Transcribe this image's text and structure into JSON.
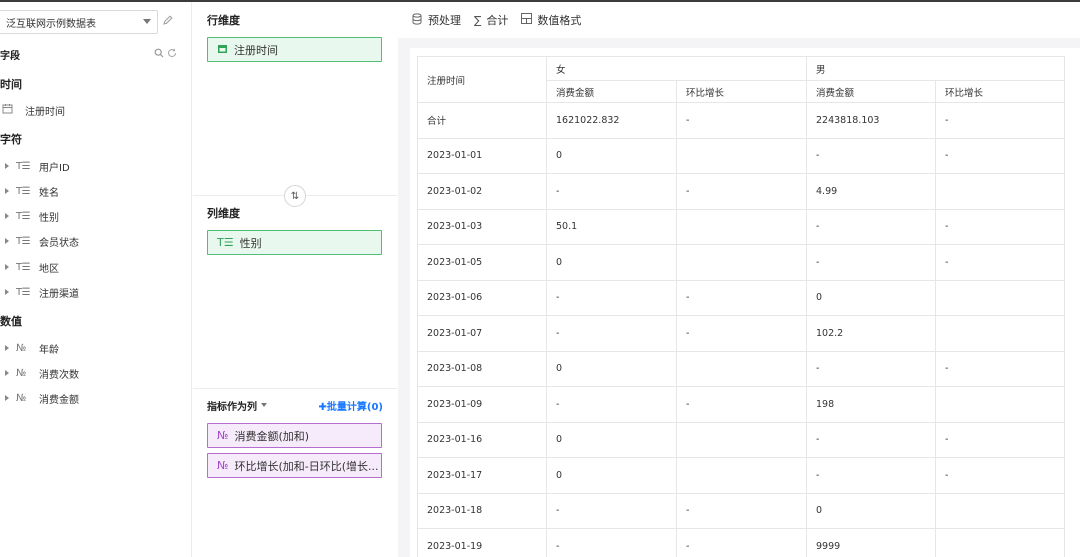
{
  "datasource": {
    "name": "泛互联网示例数据表"
  },
  "fields_panel": {
    "title": "字段",
    "groups": [
      {
        "title": "时间",
        "items": [
          {
            "icon": "calendar-icon",
            "label": "注册时间"
          }
        ]
      },
      {
        "title": "字符",
        "items": [
          {
            "icon": "text-type-icon",
            "label": "用户ID"
          },
          {
            "icon": "text-type-icon",
            "label": "姓名"
          },
          {
            "icon": "text-type-icon",
            "label": "性别"
          },
          {
            "icon": "text-type-icon",
            "label": "会员状态"
          },
          {
            "icon": "text-type-icon",
            "label": "地区"
          },
          {
            "icon": "text-type-icon",
            "label": "注册渠道"
          }
        ]
      },
      {
        "title": "数值",
        "items": [
          {
            "icon": "number-type-icon",
            "label": "年龄"
          },
          {
            "icon": "number-type-icon",
            "label": "消费次数"
          },
          {
            "icon": "number-type-icon",
            "label": "消费金额"
          }
        ]
      }
    ]
  },
  "dimensions": {
    "row_title": "行维度",
    "row_chip": "注册时间",
    "col_title": "列维度",
    "col_chip": "性别",
    "metrics_label": "指标作为列",
    "batch_calc": "批量计算(0)",
    "metric_chips": [
      "消费金额(加和)",
      "环比增长(加和-日环比(增长..."
    ]
  },
  "toolbar": {
    "preprocess": "预处理",
    "total": "合计",
    "number_format": "数值格式"
  },
  "table": {
    "row_header": "注册时间",
    "groups": [
      "女",
      "男"
    ],
    "sub_headers": [
      "消费金额",
      "环比增长",
      "消费金额",
      "环比增长"
    ],
    "rows": [
      [
        "合计",
        "1621022.832",
        "-",
        "2243818.103",
        "-"
      ],
      [
        "2023-01-01",
        "0",
        "",
        "-",
        "-"
      ],
      [
        "2023-01-02",
        "-",
        "-",
        "4.99",
        ""
      ],
      [
        "2023-01-03",
        "50.1",
        "",
        "-",
        "-"
      ],
      [
        "2023-01-05",
        "0",
        "",
        "-",
        "-"
      ],
      [
        "2023-01-06",
        "-",
        "-",
        "0",
        ""
      ],
      [
        "2023-01-07",
        "-",
        "-",
        "102.2",
        ""
      ],
      [
        "2023-01-08",
        "0",
        "",
        "-",
        "-"
      ],
      [
        "2023-01-09",
        "-",
        "-",
        "198",
        ""
      ],
      [
        "2023-01-16",
        "0",
        "",
        "-",
        "-"
      ],
      [
        "2023-01-17",
        "0",
        "",
        "-",
        "-"
      ],
      [
        "2023-01-18",
        "-",
        "-",
        "0",
        ""
      ],
      [
        "2023-01-19",
        "-",
        "-",
        "9999",
        ""
      ]
    ]
  }
}
